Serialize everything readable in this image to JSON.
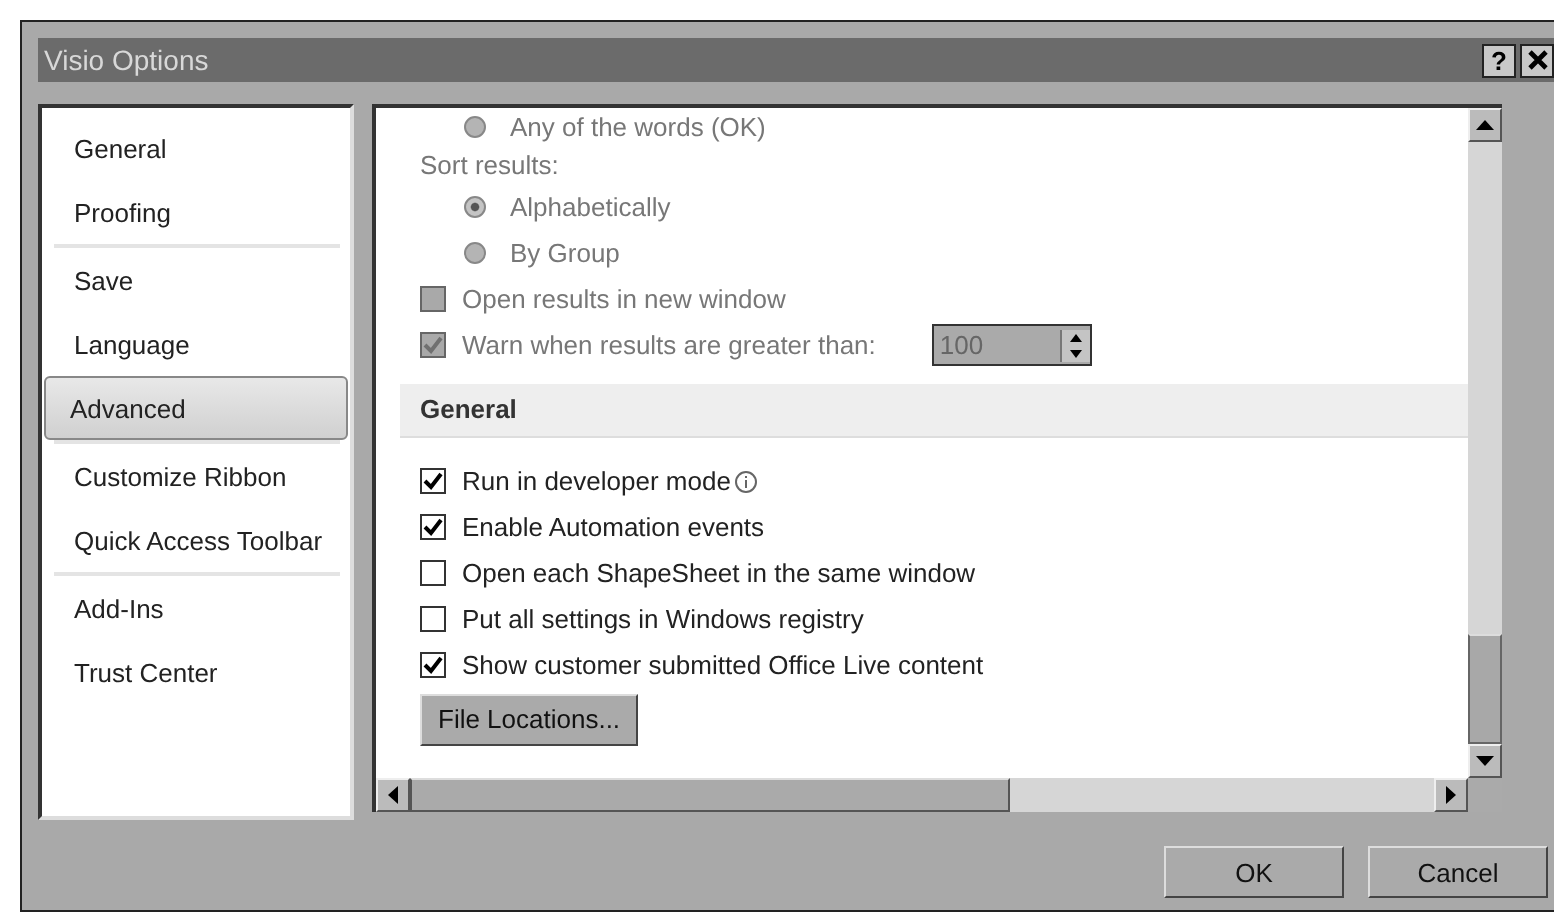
{
  "window": {
    "title": "Visio Options",
    "help": "?"
  },
  "sidebar": {
    "items": [
      {
        "label": "General",
        "selected": false,
        "divider_after": false
      },
      {
        "label": "Proofing",
        "selected": false,
        "divider_after": true
      },
      {
        "label": "Save",
        "selected": false,
        "divider_after": false
      },
      {
        "label": "Language",
        "selected": false,
        "divider_after": false
      },
      {
        "label": "Advanced",
        "selected": true,
        "divider_after": true
      },
      {
        "label": "Customize Ribbon",
        "selected": false,
        "divider_after": false
      },
      {
        "label": "Quick Access Toolbar",
        "selected": false,
        "divider_after": true
      },
      {
        "label": "Add-Ins",
        "selected": false,
        "divider_after": false
      },
      {
        "label": "Trust Center",
        "selected": false,
        "divider_after": false
      }
    ]
  },
  "content": {
    "rows": [
      {
        "kind": "radio",
        "label": "Any of the words (OK)",
        "selected": false,
        "disabled": true
      },
      {
        "kind": "label",
        "label": "Sort results:",
        "disabled": true
      },
      {
        "kind": "radio",
        "label": "Alphabetically",
        "selected": true,
        "disabled": true
      },
      {
        "kind": "radio",
        "label": "By Group",
        "selected": false,
        "disabled": true
      },
      {
        "kind": "checkbox",
        "label": "Open results in new window",
        "checked": false,
        "disabled": true
      },
      {
        "kind": "spin",
        "label": "Warn when results are greater than:",
        "checked": true,
        "disabled": true,
        "value": "100"
      },
      {
        "kind": "section",
        "label": "General"
      },
      {
        "kind": "checkbox",
        "label": "Run in developer mode",
        "checked": true,
        "disabled": false,
        "info": true
      },
      {
        "kind": "checkbox",
        "label": "Enable Automation events",
        "checked": true,
        "disabled": false
      },
      {
        "kind": "checkbox",
        "label": "Open each ShapeSheet in the same window",
        "checked": false,
        "disabled": false
      },
      {
        "kind": "checkbox",
        "label": "Put all settings in Windows registry",
        "checked": false,
        "disabled": false
      },
      {
        "kind": "checkbox",
        "label": "Show customer submitted Office Live content",
        "checked": true,
        "disabled": false
      },
      {
        "kind": "button",
        "label": "File Locations..."
      }
    ]
  },
  "buttons": [
    "OK",
    "Cancel"
  ]
}
